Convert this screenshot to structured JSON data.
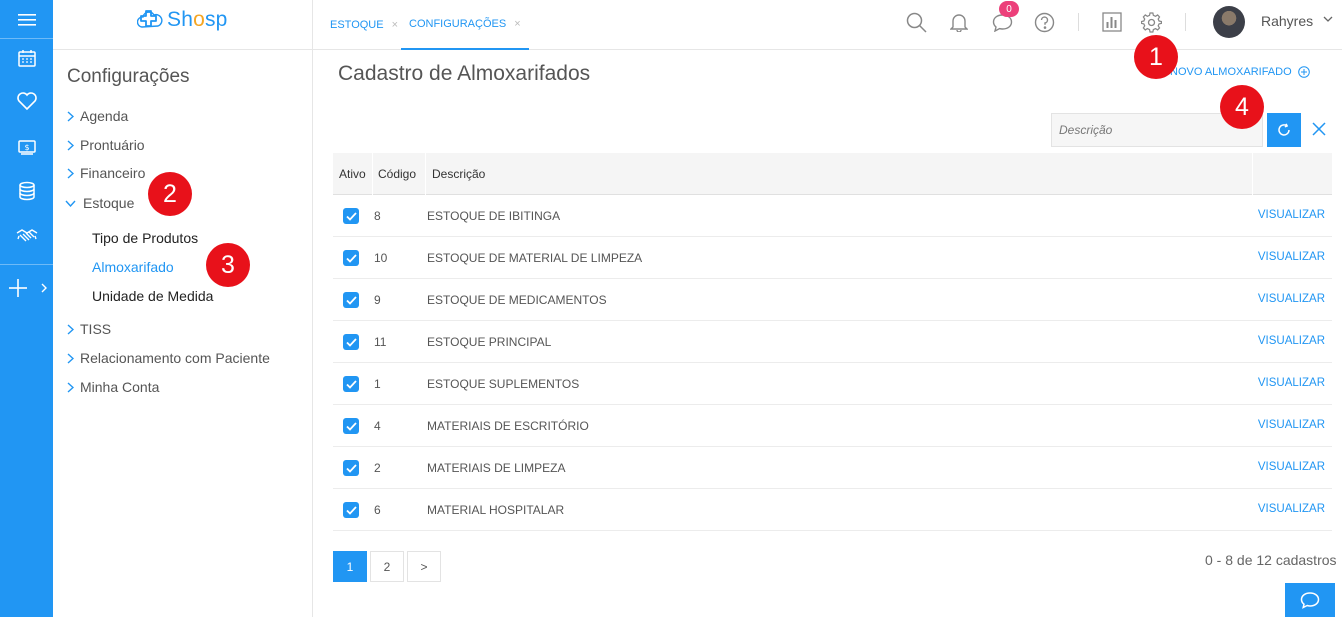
{
  "app": {
    "logo_text_a": "Sh",
    "logo_text_b": "o",
    "logo_text_c": "sp",
    "brand_color": "#2196f3",
    "marker_color": "#e8111a"
  },
  "tabs": [
    {
      "label": "ESTOQUE",
      "close": "×"
    },
    {
      "label": "CONFIGURAÇÕES",
      "close": "×"
    }
  ],
  "header": {
    "notification_count": "0",
    "username": "Rahyres"
  },
  "sidebar": {
    "title": "Configurações",
    "items": [
      {
        "label": "Agenda"
      },
      {
        "label": "Prontuário"
      },
      {
        "label": "Financeiro"
      },
      {
        "label": "Estoque"
      },
      {
        "label": "TISS"
      },
      {
        "label": "Relacionamento com Paciente"
      },
      {
        "label": "Minha Conta"
      }
    ],
    "estoque_subitems": [
      {
        "label": "Tipo de Produtos"
      },
      {
        "label": "Almoxarifado"
      },
      {
        "label": "Unidade de Medida"
      }
    ]
  },
  "markers": [
    "1",
    "2",
    "3",
    "4"
  ],
  "main": {
    "title": "Cadastro de Almoxarifados",
    "new_button": "NOVO ALMOXARIFADO",
    "search_placeholder": "Descrição",
    "columns": [
      "Ativo",
      "Código",
      "Descrição"
    ],
    "view_label": "VISUALIZAR",
    "rows": [
      {
        "active": true,
        "code": "8",
        "description": "ESTOQUE DE IBITINGA"
      },
      {
        "active": true,
        "code": "10",
        "description": "ESTOQUE DE MATERIAL DE LIMPEZA"
      },
      {
        "active": true,
        "code": "9",
        "description": "ESTOQUE DE MEDICAMENTOS"
      },
      {
        "active": true,
        "code": "11",
        "description": "ESTOQUE PRINCIPAL"
      },
      {
        "active": true,
        "code": "1",
        "description": "ESTOQUE SUPLEMENTOS"
      },
      {
        "active": true,
        "code": "4",
        "description": "MATERIAIS DE ESCRITÓRIO"
      },
      {
        "active": true,
        "code": "2",
        "description": "MATERIAIS DE LIMPEZA"
      },
      {
        "active": true,
        "code": "6",
        "description": "MATERIAL HOSPITALAR"
      }
    ],
    "pagination": {
      "pages": [
        "1",
        "2",
        ">"
      ],
      "current": "1",
      "summary": "0 - 8 de 12 cadastros"
    }
  },
  "icons": {
    "rail": [
      "menu-icon",
      "calendar-icon",
      "heart-icon",
      "money-icon",
      "database-icon",
      "handshake-icon",
      "plus-icon",
      "chevron-right-icon"
    ],
    "header": [
      "search-icon",
      "bell-icon",
      "chat-icon",
      "help-icon",
      "chart-icon",
      "gear-icon",
      "chevron-down-icon"
    ]
  }
}
